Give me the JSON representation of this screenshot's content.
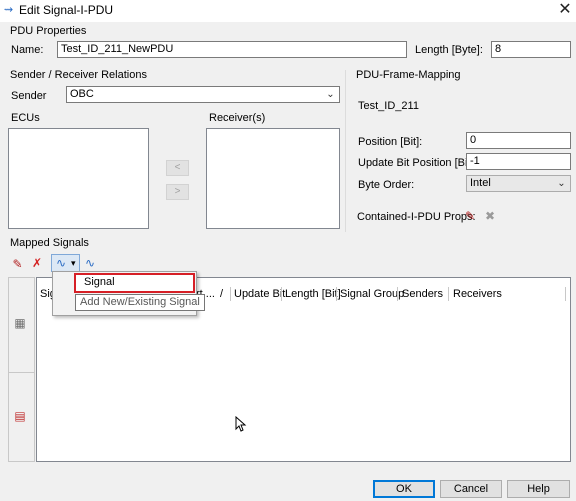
{
  "window": {
    "title": "Edit Signal-I-PDU",
    "close_glyph": "✕",
    "app_icon": "signal-arrow-icon"
  },
  "pdu_properties": {
    "group_label": "PDU Properties",
    "name_label": "Name:",
    "name_value": "Test_ID_211_NewPDU",
    "length_label": "Length [Byte]:",
    "length_value": "8"
  },
  "relations": {
    "group_label": "Sender / Receiver Relations",
    "sender_label": "Sender",
    "sender_value": "OBC",
    "ecus_label": "ECUs",
    "receivers_label": "Receiver(s)",
    "add_glyph": "<",
    "remove_glyph": ">"
  },
  "frame_mapping": {
    "group_label": "PDU-Frame-Mapping",
    "frame_name": "Test_ID_211",
    "position_label": "Position [Bit]:",
    "position_value": "0",
    "update_bit_label": "Update Bit Position [Bit]:",
    "update_bit_value": "-1",
    "byte_order_label": "Byte Order:",
    "byte_order_value": "Intel",
    "contained_label": "Contained-I-PDU Props:"
  },
  "mapped_signals": {
    "group_label": "Mapped Signals",
    "columns": [
      "Sig",
      "rt ...",
      "/",
      "Update Bit",
      "Length [Bit]",
      "Signal Group",
      "Senders",
      "Receivers"
    ]
  },
  "dropdown_menu": {
    "highlighted_item": "Signal",
    "tooltip": "Add New/Existing Signal"
  },
  "buttons": {
    "ok": "OK",
    "cancel": "Cancel",
    "help": "Help"
  },
  "colors": {
    "highlight_border": "#d61f26",
    "default_button_border": "#0078d7",
    "dialog_background": "#f0f0f0"
  }
}
